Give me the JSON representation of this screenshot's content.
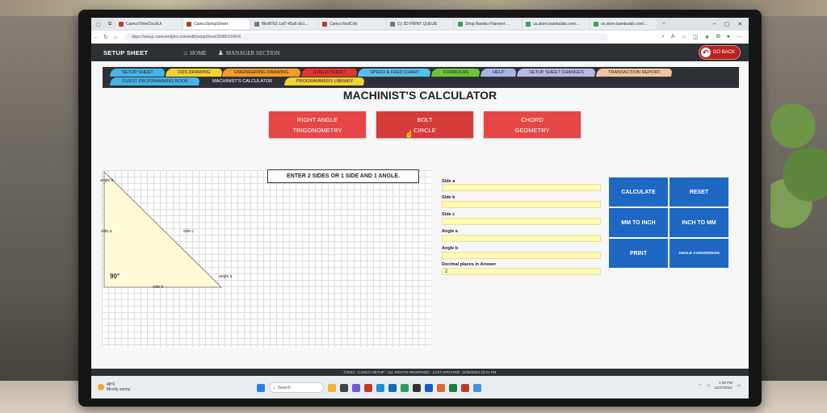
{
  "browser": {
    "tabs": [
      {
        "label": "CamcoTimeClockUI",
        "active": false,
        "color": "r"
      },
      {
        "label": "CamcoSetupSheet",
        "active": true,
        "color": "r"
      },
      {
        "label": "f8edf7b2-1af7-45a6-bb1...",
        "active": false,
        "color": "d"
      },
      {
        "label": "CamcoToolCrib",
        "active": false,
        "color": "r"
      },
      {
        "label": "(1) 3D PRINT QUEUE",
        "active": false,
        "color": "d"
      },
      {
        "label": "Shop Bambu Filament ...",
        "active": false,
        "color": "g"
      },
      {
        "label": "us.store.bambulab.com/...",
        "active": false,
        "color": "g"
      },
      {
        "label": "us.store.bambulab.com/...",
        "active": false,
        "color": "g"
      }
    ],
    "url": "https://setup.camcomfginc.com/editSetupSheet/3398/100416"
  },
  "header": {
    "brand": "SETUP SHEET",
    "home": "HOME",
    "manager": "MANAGER SECTION",
    "go_back": "GO BACK"
  },
  "menu": {
    "row1": [
      {
        "label": "SETUP SHEET",
        "color": "#46b4e8"
      },
      {
        "label": "ODS DRAWING",
        "color": "#f2d235"
      },
      {
        "label": "ENGINEERING DRAWING",
        "color": "#f39c2a"
      },
      {
        "label": "CHECK SHEET",
        "color": "#e5332a"
      },
      {
        "label": "SPEED & FEED CHART",
        "color": "#57c0ea"
      },
      {
        "label": "FORMULAS",
        "color": "#6cc43a"
      },
      {
        "label": "HELP",
        "color": "#a8b3e6"
      },
      {
        "label": "SETUP SHEET CHANGES",
        "color": "#b8b8e8"
      },
      {
        "label": "TRANSACTION REPORT",
        "color": "#f0c6a0"
      }
    ],
    "row2": [
      {
        "label": "GUEST PROGRAMMING BOOK",
        "color": "#46b4e8"
      },
      {
        "label": "MACHINIST'S CALCULATOR",
        "color": "#2d3136"
      },
      {
        "label": "PROGRAMMERS LIBRARY",
        "color": "#f2d235"
      }
    ]
  },
  "page_title": "MACHINIST'S CALCULATOR",
  "calc_buttons": {
    "right_angle": [
      "RIGHT ANGLE",
      "TRIGONOMETRY"
    ],
    "bolt_circle": [
      "BOLT",
      "CIRCLE"
    ],
    "chord": [
      "CHORD",
      "GEOMETRY"
    ]
  },
  "instruction": "ENTER 2 SIDES OR 1 SIDE AND 1 ANGLE.",
  "triangle": {
    "angle_b": "angle b",
    "side_a": "side a",
    "side_c": "side c",
    "right_angle": "90°",
    "side_b": "side b",
    "angle_a": "angle a"
  },
  "fields": {
    "side_a": {
      "label": "Side a",
      "value": ""
    },
    "side_b": {
      "label": "Side b",
      "value": ""
    },
    "side_c": {
      "label": "Side c",
      "value": ""
    },
    "angle_a": {
      "label": "Angle a",
      "value": ""
    },
    "angle_b": {
      "label": "Angle b",
      "value": ""
    },
    "decimal": {
      "label": "Decimal places in Answer",
      "value": "2"
    }
  },
  "actions": {
    "calculate": "CALCULATE",
    "reset": "RESET",
    "mm_to_inch": "MM TO INCH",
    "inch_to_mm": "INCH TO MM",
    "print": "PRINT",
    "angle_conversion": "ANGLE CONVERSION"
  },
  "footer": "©2024 · CAMCO SETUP · ALL RIGHTS RESERVED · LAST UPDATED: 11/25/2024 10:01 PM",
  "taskbar": {
    "temp": "48°F",
    "weather": "Mostly sunny",
    "search": "Search",
    "time": "1:36 PM",
    "date": "11/27/2024"
  }
}
